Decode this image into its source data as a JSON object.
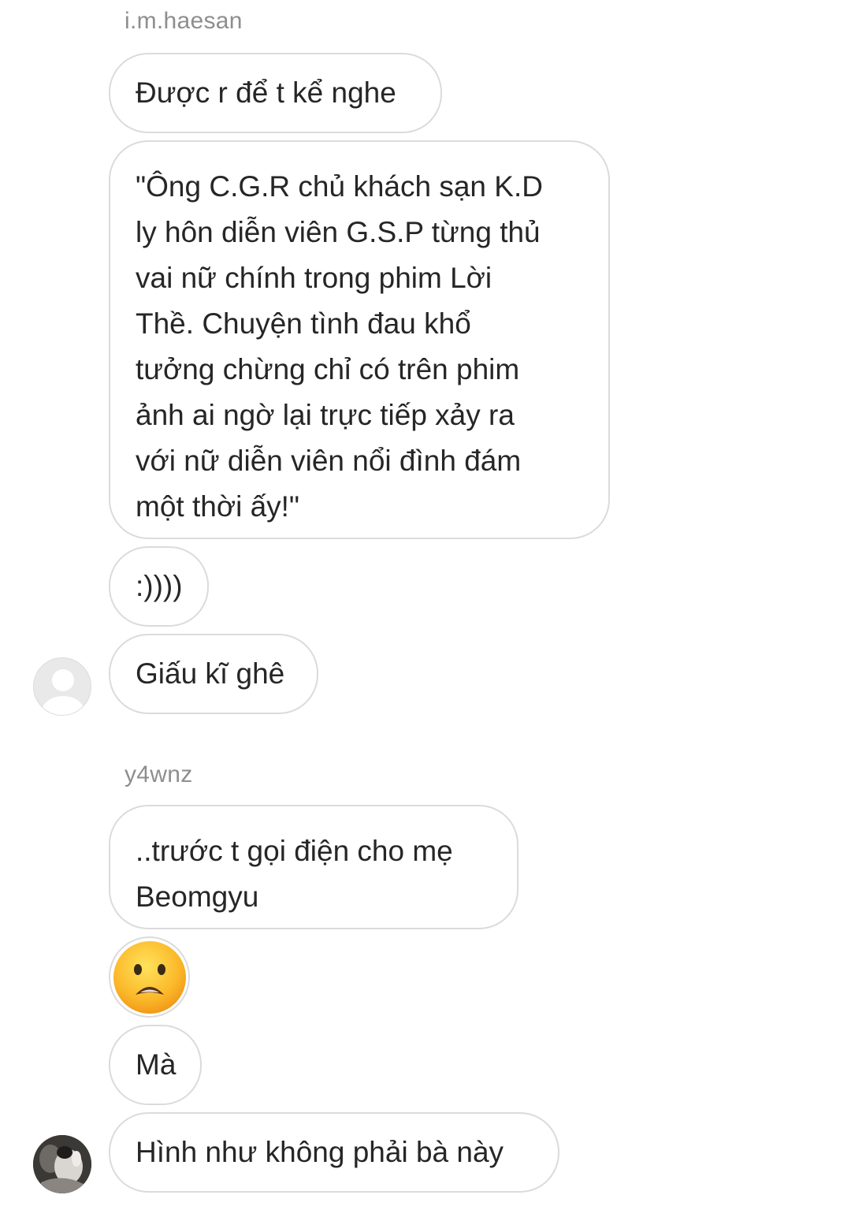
{
  "threads": [
    {
      "sender": "i.m.haesan",
      "messages": [
        "Được r để t kể nghe",
        "\"Ông C.G.R chủ khách sạn K.D\nly hôn diễn viên G.S.P từng thủ\nvai nữ chính trong phim Lời\nThề. Chuyện tình đau khổ\ntưởng chừng chỉ có trên phim\nảnh ai ngờ lại trực tiếp xảy ra\nvới nữ diễn viên nổi đình đám\nmột thời ấy!\"",
        ":))))",
        "Giấu kĩ ghê"
      ],
      "avatar_icon": "default-user-avatar-icon"
    },
    {
      "sender": "y4wnz",
      "messages": [
        "..trước t gọi điện cho mẹ\nBeomgyu",
        "Mà",
        "Hình như không phải bà này"
      ],
      "emoji_icon": "anguished-face-emoji-icon",
      "avatar_icon": "user-photo-avatar-icon"
    }
  ],
  "colors": {
    "bubble_border": "#dbdbdb",
    "sender_text": "#8e8e8e",
    "message_text": "#262626",
    "background": "#ffffff"
  }
}
